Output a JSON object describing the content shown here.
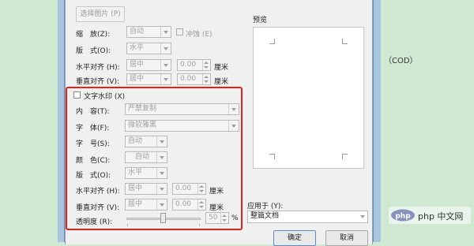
{
  "picture": {
    "select_button": "选择图片 (P)",
    "scale_label": "缩　放(Z):",
    "scale_value": "自动",
    "washout_label": "冲蚀 (E)",
    "layout_label": "版　式(O):",
    "layout_value": "水平",
    "halign_label": "水平对齐 (H):",
    "halign_value": "居中",
    "halign_offset": "0.00",
    "halign_unit": "厘米",
    "valign_label": "垂直对齐 (V):",
    "valign_value": "居中",
    "valign_offset": "0.00",
    "valign_unit": "厘米"
  },
  "text_watermark": {
    "checkbox_label": "文字水印 (X)",
    "content_label": "内　容(T):",
    "content_value": "严禁复制",
    "font_label": "字　体(F):",
    "font_value": "微软雅黑",
    "size_label": "字　号(S):",
    "size_value": "自动",
    "color_label": "颜　色(C):",
    "color_value": "自动",
    "layout_label": "版　式(O):",
    "layout_value": "水平",
    "halign_label": "水平对齐 (H):",
    "halign_value": "居中",
    "halign_offset": "0.00",
    "halign_unit": "厘米",
    "valign_label": "垂直对齐 (V):",
    "valign_value": "居中",
    "valign_offset": "0.00",
    "valign_unit": "厘米",
    "transparency_label": "透明度 (R):",
    "transparency_value": "50",
    "transparency_unit": "%",
    "transparency_level_fraction": 0.5
  },
  "preview": {
    "label": "预览"
  },
  "apply": {
    "label": "应用于 (Y):",
    "value": "整篇文档"
  },
  "buttons": {
    "ok": "确定",
    "cancel": "取消"
  },
  "side_text": "（COD）",
  "watermark": {
    "text": "php 中文网"
  }
}
